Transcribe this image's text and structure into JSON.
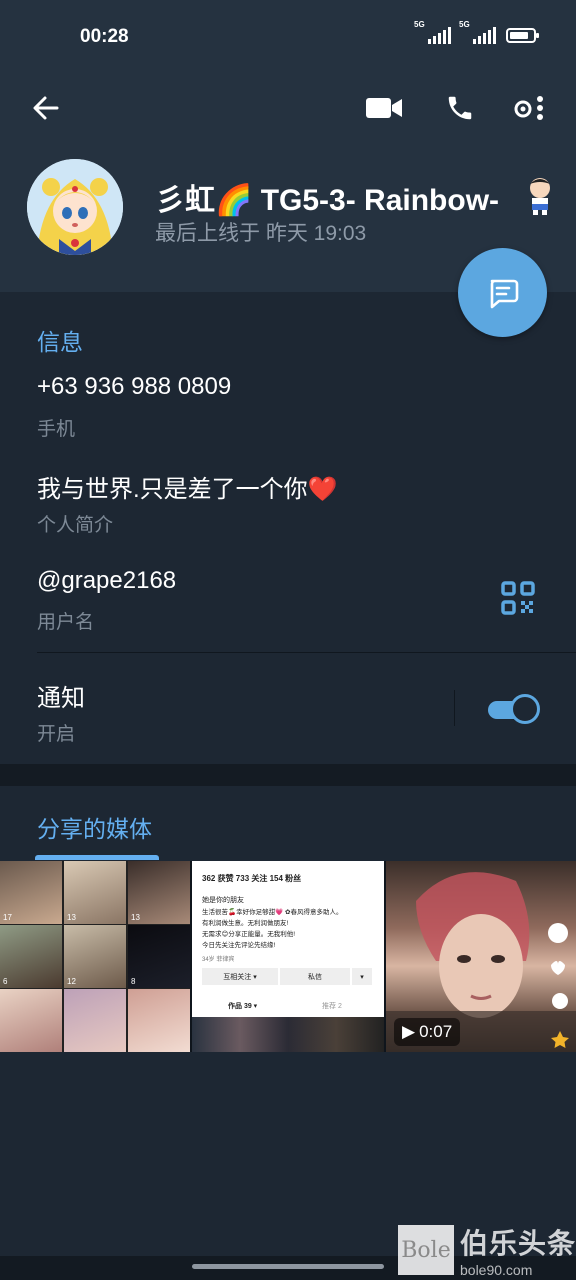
{
  "status_bar": {
    "time": "00:28",
    "signal1_label": "5G",
    "signal2_label": "5G"
  },
  "header": {
    "name": "彡虹🌈   TG5-3- Rainbow-",
    "last_seen": "最后上线于 昨天 19:03"
  },
  "info": {
    "section_title": "信息",
    "phone_value": "+63 936 988 0809",
    "phone_label": "手机",
    "bio_value": "我与世界.只是差了一个你❤️",
    "bio_label": "个人简介",
    "username_value": "@grape2168",
    "username_label": "用户名",
    "notify_title": "通知",
    "notify_state": "开启",
    "notify_enabled": true
  },
  "media": {
    "section_title": "分享的媒体",
    "grid_counts": [
      "17",
      "13",
      "13",
      "6",
      "12",
      "8"
    ],
    "profile_card": {
      "stats": "362 获赞   733 关注   154 粉丝",
      "nickname": "她是你的朋友",
      "bio_lines": [
        "生活很苦🍒幸好你足够甜💗 ✿春风得意多助人。",
        "有利润做生意。无利润做朋友!",
        "无需求😊分享正能量。无我利他!",
        "今日先关注先评论先结缘!"
      ],
      "tags": "34岁  菲律宾",
      "follow_btn": "互相关注 ▾",
      "msg_btn": "私信",
      "works_tab": "作品 39 ▾",
      "recommend_tab": "推荐 2"
    },
    "video_duration": "0:07"
  },
  "watermark": {
    "logo": "Bole",
    "name": "伯乐头条",
    "url": "bole90.com"
  },
  "colors": {
    "background": "#1d2733",
    "header": "#253240",
    "accent": "#64aff0",
    "fab": "#5ca7e0",
    "secondary_text": "#7d8996"
  }
}
